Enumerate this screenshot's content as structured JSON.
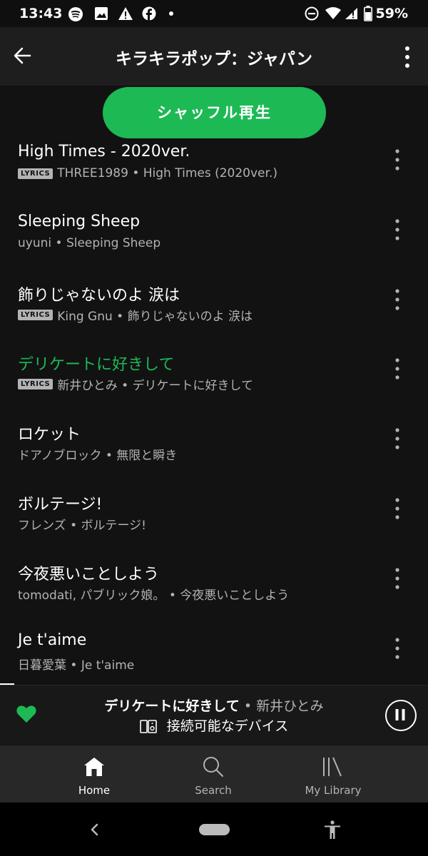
{
  "status_bar": {
    "time": "13:43",
    "battery": "59%"
  },
  "header": {
    "title": "キラキラポップ：ジャパン"
  },
  "shuffle_button": "シャッフル再生",
  "tracks": [
    {
      "title": "High Times - 2020ver.",
      "lyrics": "LYRICS",
      "subtitle": "THREE1989 • High Times (2020ver.)"
    },
    {
      "title": "Sleeping Sheep",
      "lyrics": "",
      "subtitle": "uyuni • Sleeping Sheep"
    },
    {
      "title": "飾りじゃないのよ 涙は",
      "lyrics": "LYRICS",
      "subtitle": "King Gnu • 飾りじゃないのよ 涙は"
    },
    {
      "title": "デリケートに好きして",
      "lyrics": "LYRICS",
      "subtitle": "新井ひとみ • デリケートに好きして"
    },
    {
      "title": "ロケット",
      "lyrics": "",
      "subtitle": "ドアノブロック • 無限と瞬き"
    },
    {
      "title": "ボルテージ!",
      "lyrics": "",
      "subtitle": "フレンズ • ボルテージ!"
    },
    {
      "title": "今夜悪いことしよう",
      "lyrics": "",
      "subtitle": "tomodati, パブリック娘。 • 今夜悪いことしよう"
    },
    {
      "title": "Je t'aime",
      "lyrics": "",
      "subtitle": "日暮愛葉 • Je t'aime"
    }
  ],
  "now_playing": {
    "title": "デリケートに好きして",
    "separator": " • ",
    "artist": "新井ひとみ",
    "device": "接続可能なデバイス"
  },
  "bottom_nav": {
    "home": "Home",
    "search": "Search",
    "library": "My Library"
  },
  "colors": {
    "accent": "#1db954",
    "background": "#121212"
  }
}
